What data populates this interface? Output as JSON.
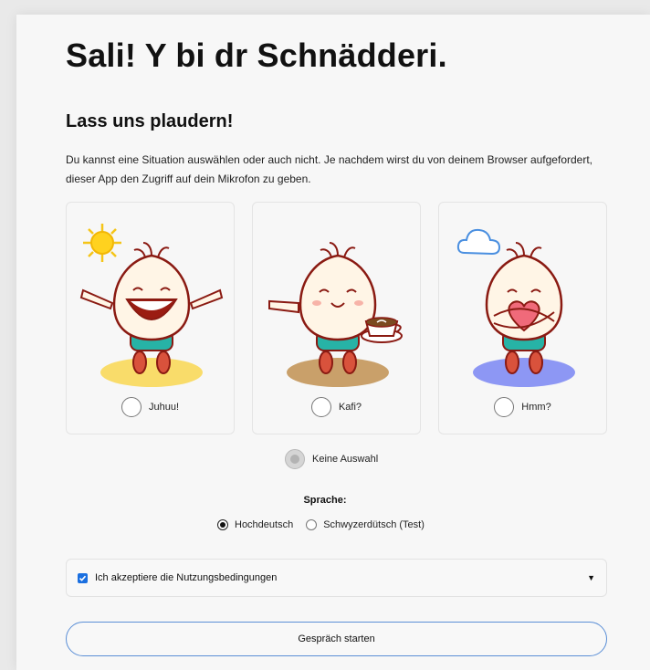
{
  "header": {
    "title": "Sali! Y bi dr Schnädderi.",
    "subtitle": "Lass uns plaudern!",
    "intro": "Du kannst eine Situation auswählen oder auch nicht. Je nachdem wirst du von deinem Browser aufgefordert, dieser App den Zugriff auf dein Mikrofon zu geben."
  },
  "situations": [
    {
      "label": "Juhuu!",
      "decoration": "sun-icon",
      "ground_color": "#f9dc6a"
    },
    {
      "label": "Kafi?",
      "decoration": "coffee-cup-icon",
      "ground_color": "#c9a06a"
    },
    {
      "label": "Hmm?",
      "decoration": "cloud-icon",
      "ground_color": "#8d97f4"
    }
  ],
  "no_selection": {
    "label": "Keine Auswahl"
  },
  "language": {
    "label": "Sprache:",
    "options": [
      "Hochdeutsch",
      "Schwyzerdütsch (Test)"
    ],
    "selected": "Hochdeutsch"
  },
  "terms": {
    "label": "Ich akzeptiere die Nutzungsbedingungen",
    "checked": true
  },
  "start_button": {
    "label": "Gespräch starten"
  },
  "colors": {
    "accent": "#1a6fe0",
    "button_border": "#5b8fd6",
    "character_outline": "#8a1a12"
  }
}
